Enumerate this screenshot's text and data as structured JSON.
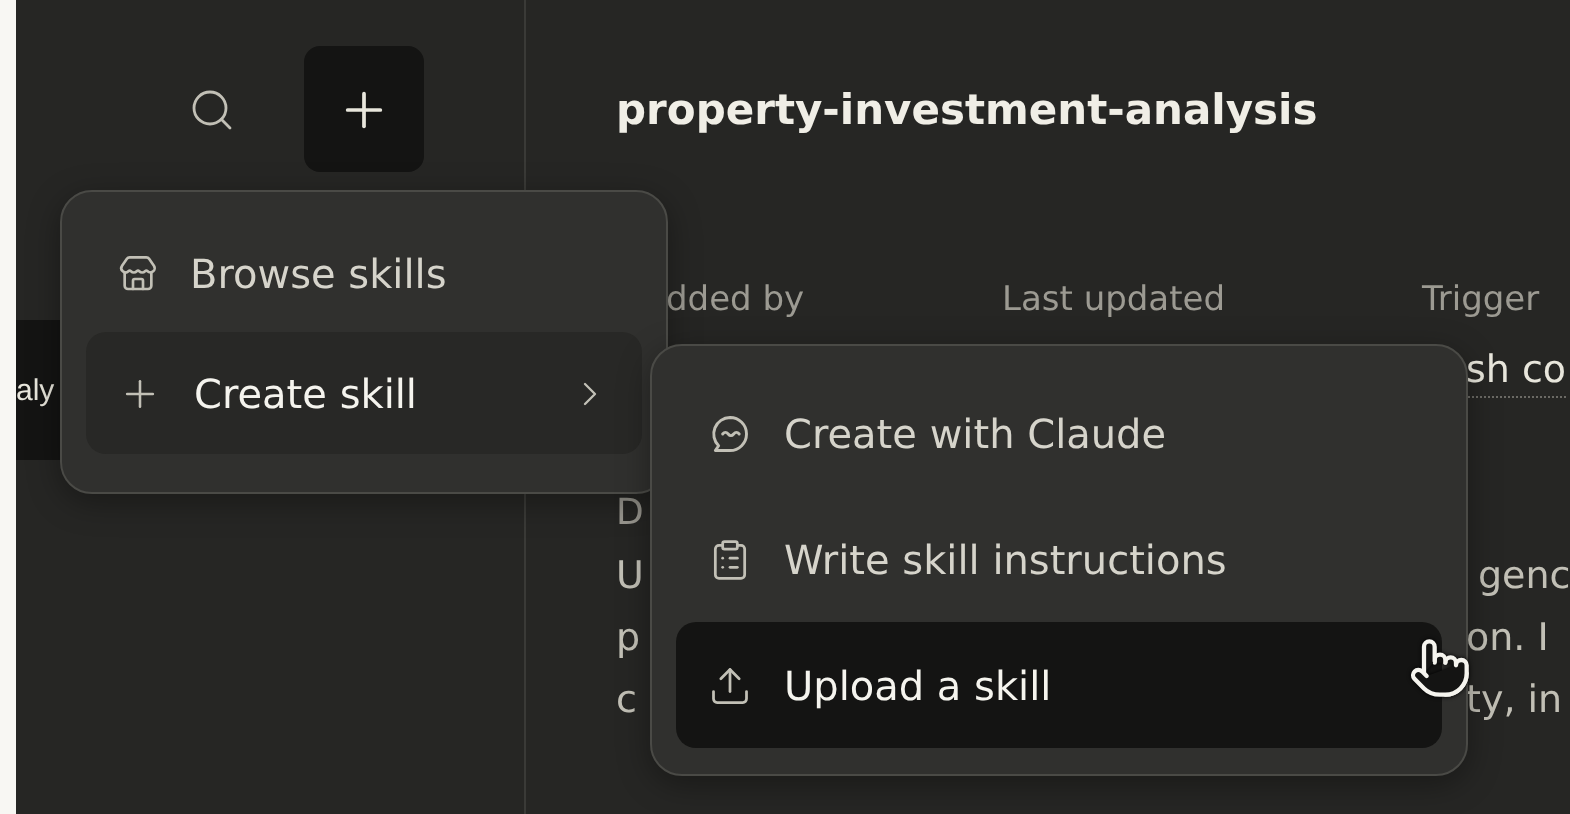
{
  "sidebar": {
    "items": [
      {
        "label": "aly",
        "selected": true
      }
    ]
  },
  "header": {
    "title": "property-investment-analysis"
  },
  "details": {
    "columns": [
      {
        "label": "dded by"
      },
      {
        "label": "Last updated"
      },
      {
        "label": "Trigger",
        "value": "sh co"
      }
    ],
    "description_label": "D",
    "description_lines": [
      {
        "left": "U",
        "right": "genc"
      },
      {
        "left": "p",
        "right": "on. I"
      },
      {
        "left": "c",
        "right": "ty, in"
      }
    ]
  },
  "menu": {
    "items": [
      {
        "label": "Browse skills",
        "kind": "action",
        "selected": false
      },
      {
        "label": "Create skill",
        "kind": "submenu",
        "selected": true
      }
    ]
  },
  "submenu": {
    "items": [
      {
        "label": "Create with Claude",
        "selected": false
      },
      {
        "label": "Write skill instructions",
        "selected": false
      },
      {
        "label": "Upload a skill",
        "selected": true
      }
    ]
  }
}
